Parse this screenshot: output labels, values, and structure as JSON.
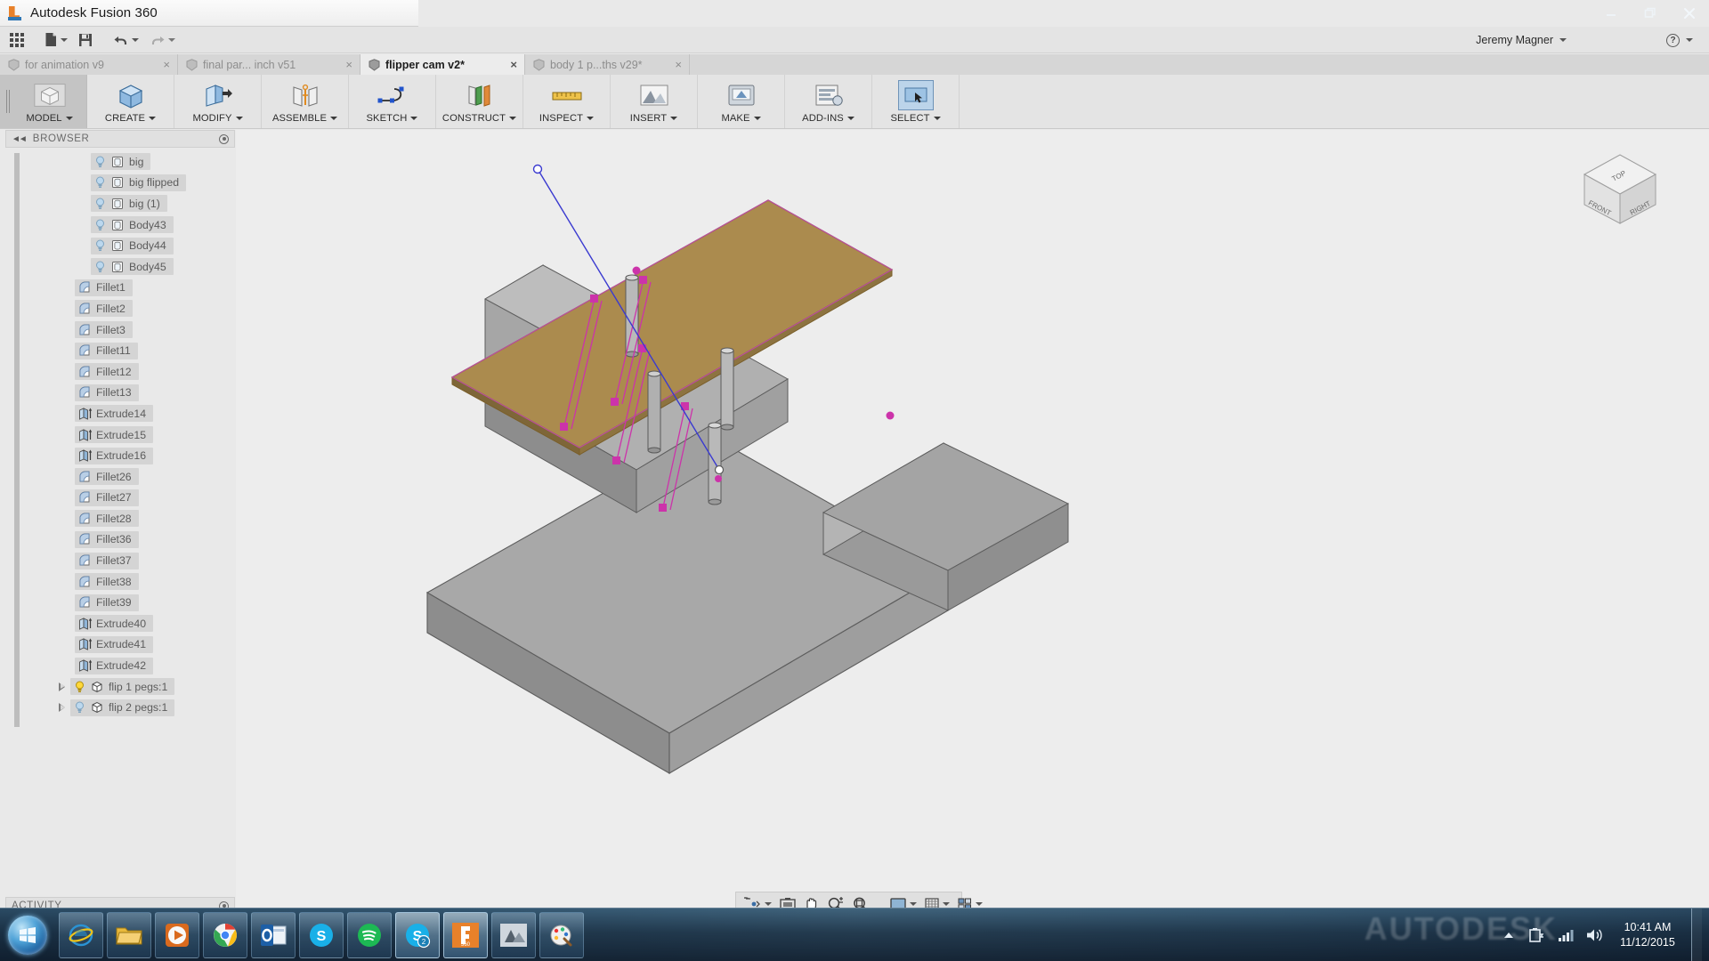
{
  "window": {
    "app_title": "Autodesk Fusion 360",
    "logo_icon": "fusion-logo-icon",
    "controls": [
      {
        "name": "minimize-button",
        "glyph": "minimize-icon"
      },
      {
        "name": "restore-button",
        "glyph": "restore-icon"
      },
      {
        "name": "close-button",
        "glyph": "close-icon"
      }
    ]
  },
  "quick_access": {
    "apps_label": "apps-grid-icon",
    "new_label": "new-document-icon",
    "save_label": "save-icon",
    "undo_label": "undo-icon",
    "redo_label": "redo-icon",
    "user_name": "Jeremy Magner",
    "help_label": "help-icon"
  },
  "doc_tabs": [
    {
      "label": "for animation v9",
      "active": false,
      "close": "×"
    },
    {
      "label": "final par... inch v51",
      "active": false,
      "close": "×"
    },
    {
      "label": "flipper cam v2*",
      "active": true,
      "close": "×"
    },
    {
      "label": "body 1 p...ths v29*",
      "active": false,
      "close": "×"
    }
  ],
  "ribbon": {
    "workspace": {
      "label": "MODEL",
      "icon": "workspace-cube-icon",
      "has_caret": true
    },
    "items": [
      {
        "label": "CREATE",
        "icon": "create-box-icon",
        "has_caret": true,
        "selected": false
      },
      {
        "label": "MODIFY",
        "icon": "modify-press-pull-icon",
        "has_caret": true,
        "selected": false
      },
      {
        "label": "ASSEMBLE",
        "icon": "assemble-joint-icon",
        "has_caret": true,
        "selected": false
      },
      {
        "label": "SKETCH",
        "icon": "sketch-spline-icon",
        "has_caret": true,
        "selected": false
      },
      {
        "label": "CONSTRUCT",
        "icon": "construct-plane-icon",
        "has_caret": true,
        "selected": false
      },
      {
        "label": "INSPECT",
        "icon": "inspect-measure-icon",
        "has_caret": true,
        "selected": false
      },
      {
        "label": "INSERT",
        "icon": "insert-image-icon",
        "has_caret": true,
        "selected": false
      },
      {
        "label": "MAKE",
        "icon": "make-3dprint-icon",
        "has_caret": true,
        "selected": false
      },
      {
        "label": "ADD-INS",
        "icon": "addins-script-icon",
        "has_caret": true,
        "selected": false
      },
      {
        "label": "SELECT",
        "icon": "select-cursor-icon",
        "has_caret": true,
        "selected": true
      }
    ]
  },
  "browser": {
    "title": "BROWSER",
    "collapse_icon": "collapse-left-icon",
    "options_icon": "panel-options-icon",
    "items": [
      {
        "label": "big",
        "type": "body",
        "bulb": "on-dim",
        "icon": "body-icon"
      },
      {
        "label": "big flipped",
        "type": "body",
        "bulb": "on-dim",
        "icon": "body-icon"
      },
      {
        "label": "big (1)",
        "type": "body",
        "bulb": "on-dim",
        "icon": "body-icon"
      },
      {
        "label": "Body43",
        "type": "body",
        "bulb": "on-dim",
        "icon": "body-icon"
      },
      {
        "label": "Body44",
        "type": "body",
        "bulb": "on-dim",
        "icon": "body-icon"
      },
      {
        "label": "Body45",
        "type": "body",
        "bulb": "on-dim",
        "icon": "body-icon"
      },
      {
        "label": "Fillet1",
        "type": "feature",
        "icon": "fillet-icon"
      },
      {
        "label": "Fillet2",
        "type": "feature",
        "icon": "fillet-icon"
      },
      {
        "label": "Fillet3",
        "type": "feature",
        "icon": "fillet-icon"
      },
      {
        "label": "Fillet11",
        "type": "feature",
        "icon": "fillet-icon"
      },
      {
        "label": "Fillet12",
        "type": "feature",
        "icon": "fillet-icon"
      },
      {
        "label": "Fillet13",
        "type": "feature",
        "icon": "fillet-icon"
      },
      {
        "label": "Extrude14",
        "type": "feature",
        "icon": "extrude-icon"
      },
      {
        "label": "Extrude15",
        "type": "feature",
        "icon": "extrude-icon"
      },
      {
        "label": "Extrude16",
        "type": "feature",
        "icon": "extrude-icon"
      },
      {
        "label": "Fillet26",
        "type": "feature",
        "icon": "fillet-icon"
      },
      {
        "label": "Fillet27",
        "type": "feature",
        "icon": "fillet-icon"
      },
      {
        "label": "Fillet28",
        "type": "feature",
        "icon": "fillet-icon"
      },
      {
        "label": "Fillet36",
        "type": "feature",
        "icon": "fillet-icon"
      },
      {
        "label": "Fillet37",
        "type": "feature",
        "icon": "fillet-icon"
      },
      {
        "label": "Fillet38",
        "type": "feature",
        "icon": "fillet-icon"
      },
      {
        "label": "Fillet39",
        "type": "feature",
        "icon": "fillet-icon"
      },
      {
        "label": "Extrude40",
        "type": "feature",
        "icon": "extrude-icon"
      },
      {
        "label": "Extrude41",
        "type": "feature",
        "icon": "extrude-icon"
      },
      {
        "label": "Extrude42",
        "type": "feature",
        "icon": "extrude-icon"
      },
      {
        "label": "flip 1 pegs:1",
        "type": "component",
        "bulb": "on-bright",
        "icon": "component-icon",
        "expander": true
      },
      {
        "label": "flip 2 pegs:1",
        "type": "component",
        "bulb": "on-dim",
        "icon": "component-icon",
        "expander": true
      }
    ]
  },
  "activity": {
    "title": "ACTIVITY",
    "options_icon": "panel-options-icon"
  },
  "viewcube": {
    "top_label": "TOP",
    "front_label": "FRONT",
    "right_label": "RIGHT"
  },
  "navbar": {
    "items": [
      {
        "name": "orbit-icon",
        "caret": true
      },
      {
        "name": "look-at-icon",
        "caret": false
      },
      {
        "name": "pan-hand-icon",
        "caret": false
      },
      {
        "name": "zoom-icon",
        "caret": false
      },
      {
        "name": "fit-icon",
        "caret": false
      },
      {
        "name": "display-settings-icon",
        "caret": true
      },
      {
        "name": "grid-snap-icon",
        "caret": true
      },
      {
        "name": "viewports-icon",
        "caret": true
      }
    ]
  },
  "taskbar": {
    "start_icon": "windows-start-orb",
    "pinned": [
      {
        "name": "internet-explorer-icon",
        "active": false
      },
      {
        "name": "file-explorer-icon",
        "active": false
      },
      {
        "name": "media-player-icon",
        "active": false
      },
      {
        "name": "google-chrome-icon",
        "active": false
      },
      {
        "name": "outlook-icon",
        "active": false
      },
      {
        "name": "skype-icon",
        "active": false
      },
      {
        "name": "spotify-icon",
        "active": false
      },
      {
        "name": "skype-2-icon",
        "active": true
      },
      {
        "name": "fusion-360-icon",
        "active": true
      },
      {
        "name": "meshmixer-icon",
        "active": false
      },
      {
        "name": "paint-icon",
        "active": false
      }
    ],
    "watermark": "AUTODESK",
    "tray": [
      {
        "name": "show-hidden-icons-icon"
      },
      {
        "name": "battery-icon"
      },
      {
        "name": "network-signal-icon"
      },
      {
        "name": "volume-icon"
      }
    ],
    "clock_time": "10:41 AM",
    "clock_date": "11/12/2015"
  },
  "colors": {
    "accent_blue": "#3c6fa8",
    "model_top_face": "#b08f4e",
    "model_side": "#8e8e8e",
    "sketch_magenta": "#cc33aa",
    "sketch_line_blue": "#3a3ad0",
    "selected_tool_bg": "#bcd4ea"
  },
  "model": {
    "description": "Isometric CAD assembly: tan top plate over grey base with cylindrical pegs and magenta construction lines"
  }
}
